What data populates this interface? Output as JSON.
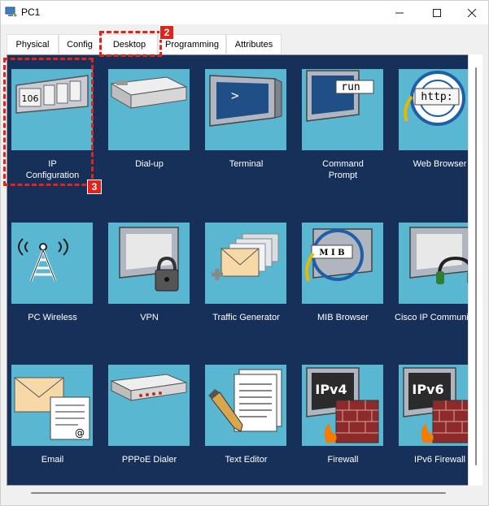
{
  "window": {
    "title": "PC1"
  },
  "tabs": [
    {
      "label": "Physical"
    },
    {
      "label": "Config"
    },
    {
      "label": "Desktop"
    },
    {
      "label": "Programming"
    },
    {
      "label": "Attributes"
    }
  ],
  "apps": [
    {
      "label": "IP\nConfiguration",
      "icon": "ip-configuration-icon"
    },
    {
      "label": "Dial-up",
      "icon": "modem-icon"
    },
    {
      "label": "Terminal",
      "icon": "terminal-icon"
    },
    {
      "label": "Command\nPrompt",
      "icon": "command-prompt-icon"
    },
    {
      "label": "Web Browser",
      "icon": "web-browser-icon"
    },
    {
      "label": "PC Wireless",
      "icon": "wireless-tower-icon"
    },
    {
      "label": "VPN",
      "icon": "vpn-lock-icon"
    },
    {
      "label": "Traffic Generator",
      "icon": "traffic-generator-icon"
    },
    {
      "label": "MIB Browser",
      "icon": "mib-browser-icon"
    },
    {
      "label": "Cisco IP Communicator",
      "icon": "ip-communicator-icon"
    },
    {
      "label": "Email",
      "icon": "email-icon"
    },
    {
      "label": "PPPoE Dialer",
      "icon": "pppoe-dialer-icon"
    },
    {
      "label": "Text Editor",
      "icon": "text-editor-icon"
    },
    {
      "label": "Firewall",
      "icon": "firewall-icon"
    },
    {
      "label": "IPv6 Firewall",
      "icon": "ipv6-firewall-icon"
    }
  ],
  "icon_text": {
    "ip_config_number": "106",
    "command_prompt_word": "run",
    "web_browser_word": "http:",
    "terminal_prompt": ">",
    "mib_word": "M I B",
    "firewall_v4": "IPv4",
    "firewall_v6": "IPv6",
    "email_at": "@"
  },
  "callouts": [
    {
      "number": "2"
    },
    {
      "number": "3"
    }
  ],
  "colors": {
    "desktop_bg": "#16305a",
    "tile_bg": "#5ab7d2",
    "callout": "#e2231a"
  }
}
